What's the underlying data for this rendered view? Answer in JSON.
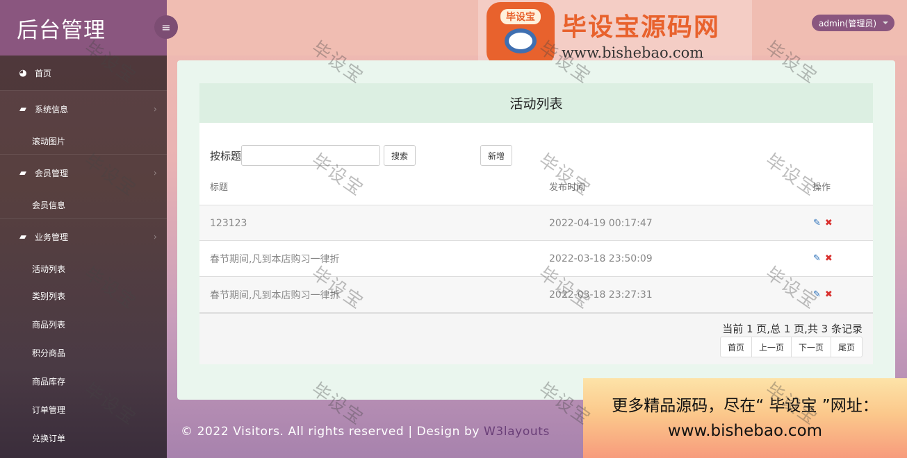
{
  "sidebar": {
    "brand": "后台管理",
    "home": "首页",
    "groups": [
      {
        "label": "系统信息",
        "subs": [
          "滚动图片"
        ]
      },
      {
        "label": "会员管理",
        "subs": [
          "会员信息"
        ]
      },
      {
        "label": "业务管理",
        "subs": [
          "活动列表",
          "类别列表",
          "商品列表",
          "积分商品",
          "商品库存",
          "订单管理",
          "兑换订单"
        ]
      }
    ]
  },
  "header": {
    "toggle_icon": "≡",
    "logo_badge_text": "毕设宝",
    "logo_title": "毕设宝源码网",
    "logo_url": "www.bishebao.com",
    "user": "admin(管理员)"
  },
  "main": {
    "title": "活动列表",
    "search_label": "按标题",
    "search_value": "",
    "search_button": "搜索",
    "add_button": "新增",
    "columns": [
      "标题",
      "发布时间",
      "操作"
    ],
    "rows": [
      {
        "title": "123123",
        "time": "2022-04-19 00:17:47"
      },
      {
        "title": "春节期间,凡到本店购习一律折",
        "time": "2022-03-18 23:50:09"
      },
      {
        "title": "春节期间,凡到本店购习一律折",
        "time": "2022-03-18 23:27:31"
      }
    ],
    "pager_info": "当前 1 页,总 1 页,共 3 条记录",
    "pager_buttons": [
      "首页",
      "上一页",
      "下一页",
      "尾页"
    ]
  },
  "footer": {
    "text": "© 2022 Visitors. All rights reserved | Design by",
    "link": "W3layouts"
  },
  "promo": {
    "line1": "更多精品源码，尽在“ 毕设宝 ”网址：",
    "line2": "www.bishebao.com"
  },
  "watermark": "毕设宝",
  "colors": {
    "brand_purple": "#8a567f",
    "sidebar_bg": "#58403f",
    "topbar_bg": "#f0bdb2",
    "panel_bg": "#eaf6ee",
    "edit_blue": "#2a6fb8",
    "delete_red": "#d9312f",
    "logo_orange": "#e8622d"
  },
  "icons": {
    "home": "dashboard-icon",
    "group": "book-icon",
    "chevron": "chevron-right-icon",
    "edit": "edit-icon",
    "delete": "delete-icon"
  }
}
